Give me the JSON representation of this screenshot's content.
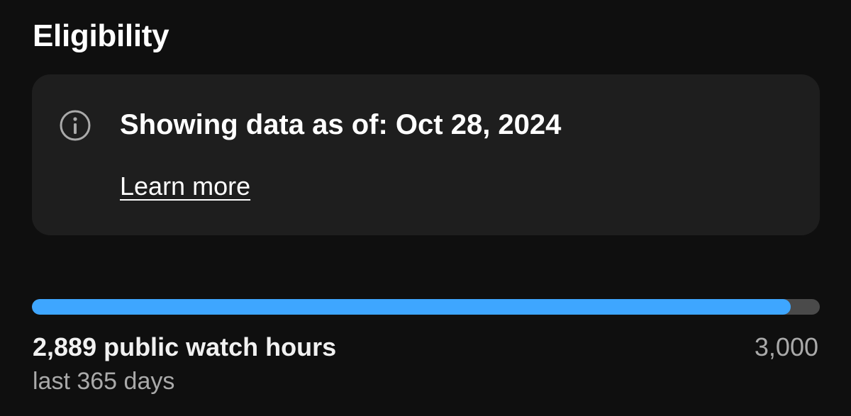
{
  "header": {
    "title": "Eligibility"
  },
  "info_card": {
    "icon": "info-icon",
    "message": "Showing data as of: Oct 28, 2024",
    "link_label": "Learn more"
  },
  "progress": {
    "value_label": "2,889 public watch hours",
    "period_label": "last 365 days",
    "target_label": "3,000",
    "current": 2889,
    "target": 3000,
    "fill_color": "#3ea6ff",
    "track_color": "#4a4a4a"
  }
}
